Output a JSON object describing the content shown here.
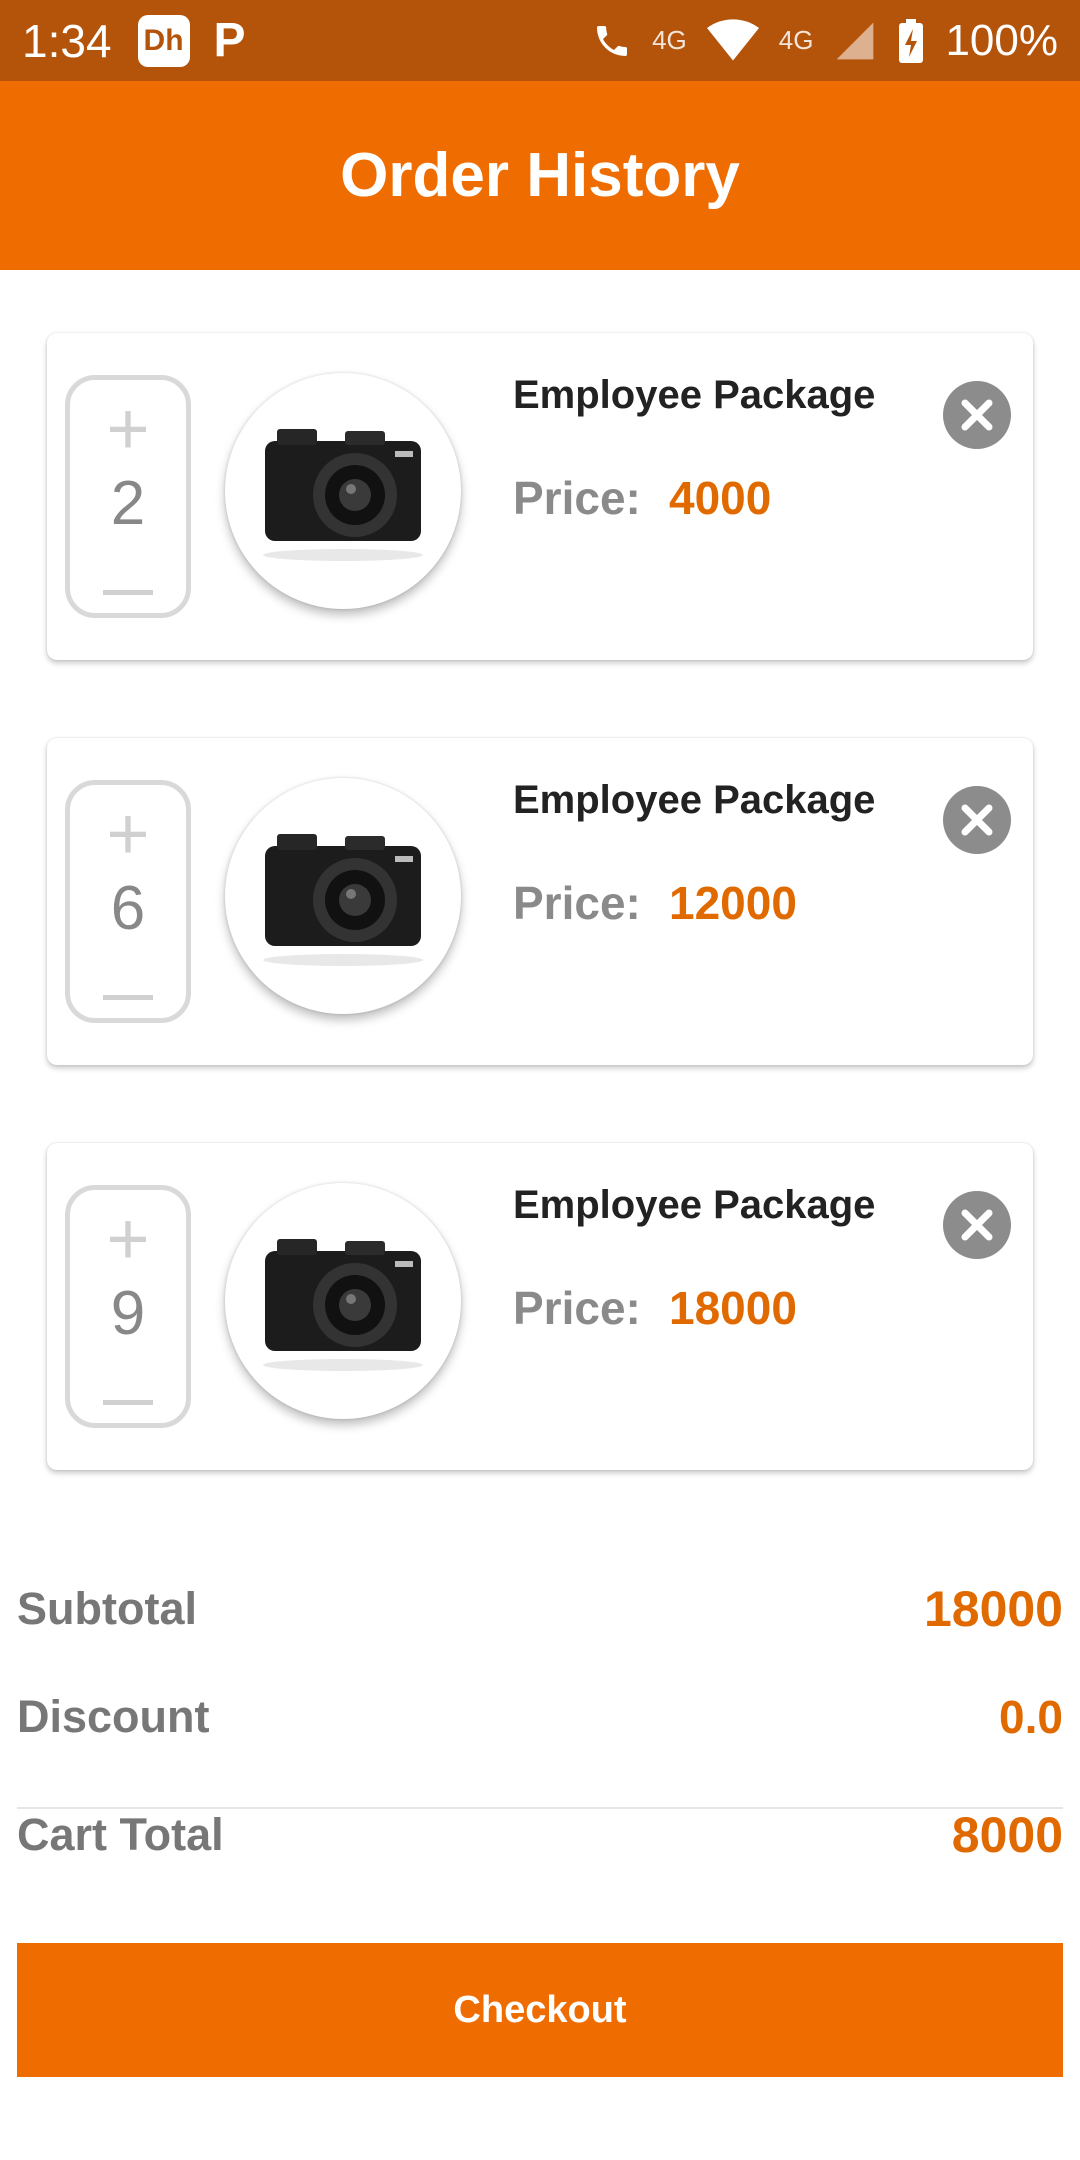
{
  "status_bar": {
    "time": "1:34",
    "app_badge": "Dh",
    "parking_icon": "P",
    "net_label_1": "4G",
    "net_label_2": "4G",
    "battery": "100%"
  },
  "header": {
    "title": "Order History"
  },
  "items": [
    {
      "quantity": "2",
      "title": "Employee Package",
      "price_label": "Price:",
      "price": "4000",
      "icon": "camera-image"
    },
    {
      "quantity": "6",
      "title": "Employee Package",
      "price_label": "Price:",
      "price": "12000",
      "icon": "camera-image"
    },
    {
      "quantity": "9",
      "title": "Employee Package",
      "price_label": "Price:",
      "price": "18000",
      "icon": "camera-image"
    }
  ],
  "summary": {
    "subtotal_label": "Subtotal",
    "subtotal_value": "18000",
    "discount_label": "Discount",
    "discount_value": "0.0",
    "total_label": "Cart Total",
    "total_value": "8000"
  },
  "checkout_label": "Checkout",
  "colors": {
    "accent": "#ef6c00",
    "status_bar": "#b4530a",
    "price": "#e06a00"
  }
}
